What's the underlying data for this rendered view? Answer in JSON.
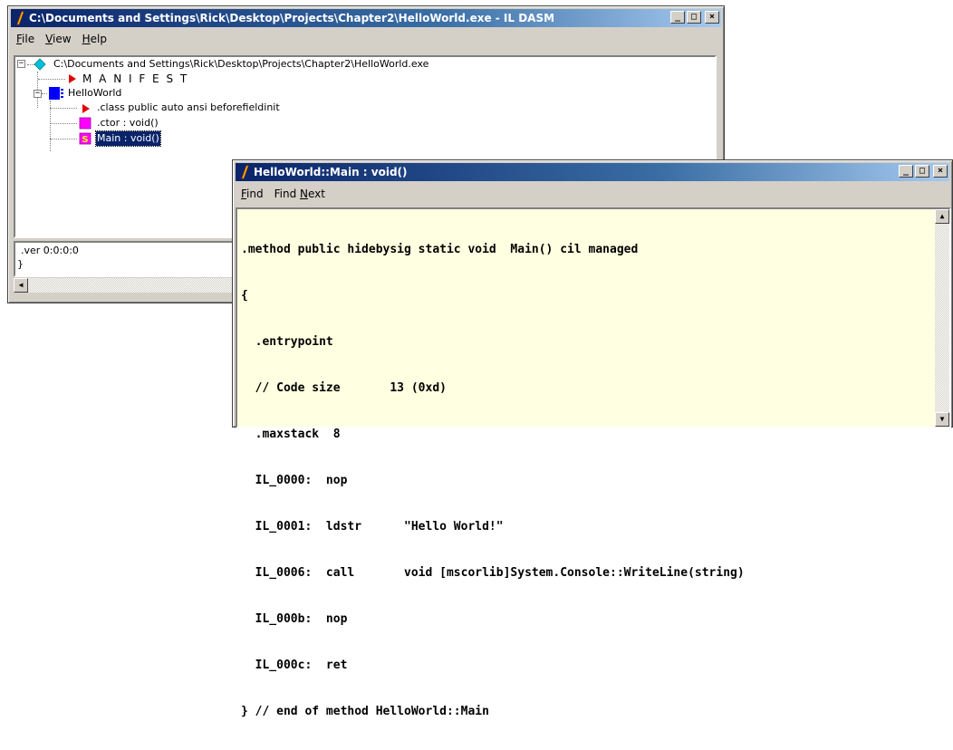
{
  "main_window": {
    "title": "C:\\Documents and Settings\\Rick\\Desktop\\Projects\\Chapter2\\HelloWorld.exe - IL DASM",
    "menu": [
      {
        "label_pre": "",
        "label_ul": "F",
        "label_post": "ile"
      },
      {
        "label_pre": "",
        "label_ul": "V",
        "label_post": "iew"
      },
      {
        "label_pre": "",
        "label_ul": "H",
        "label_post": "elp"
      }
    ],
    "tree": {
      "root": "C:\\Documents and Settings\\Rick\\Desktop\\Projects\\Chapter2\\HelloWorld.exe",
      "manifest": "M A N I F E S T",
      "namespace": "HelloWorld",
      "class_decl": ".class public auto ansi beforefieldinit",
      "ctor": ".ctor : void()",
      "main": "Main : void()"
    },
    "info_lines": [
      ".ver 0:0:0:0",
      "}"
    ]
  },
  "code_window": {
    "title": "HelloWorld::Main : void()",
    "menu": [
      {
        "label_pre": "",
        "label_ul": "F",
        "label_post": "ind"
      },
      {
        "label_pre": "Find ",
        "label_ul": "N",
        "label_post": "ext"
      }
    ],
    "code_lines": [
      ".method public hidebysig static void  Main() cil managed",
      "{",
      "  .entrypoint",
      "  // Code size       13 (0xd)",
      "  .maxstack  8",
      "  IL_0000:  nop",
      "  IL_0001:  ldstr      \"Hello World!\"",
      "  IL_0006:  call       void [mscorlib]System.Console::WriteLine(string)",
      "  IL_000b:  nop",
      "  IL_000c:  ret",
      "} // end of method HelloWorld::Main"
    ]
  },
  "title_buttons": {
    "minimize": "_",
    "maximize": "□",
    "close": "×"
  },
  "colors": {
    "titlebar_active": "#0a246a",
    "code_background": "#ffffe1",
    "manifest_icon": "#e00000",
    "namespace_icon": "#0000ff",
    "ctor_icon": "#ff00ff",
    "static_method_icon": "#ff00ff",
    "root_icon": "#00c0e0"
  },
  "icons": [
    "ildasm-app-icon",
    "assembly-diamond-icon",
    "manifest-triangle-icon",
    "namespace-icon",
    "class-triangle-icon",
    "method-icon",
    "static-method-icon"
  ]
}
